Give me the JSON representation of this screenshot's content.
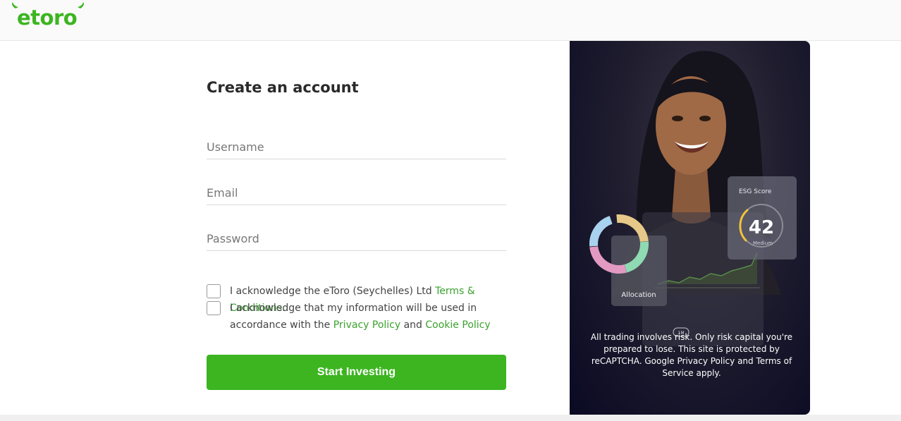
{
  "brand": {
    "name": "eToro",
    "logo_text": "eToro",
    "accent": "#3cb521",
    "link_color": "#3aa22d",
    "panel_bg": "#0b0a24"
  },
  "form": {
    "title": "Create an account",
    "username_placeholder": "Username",
    "email_placeholder": "Email",
    "password_placeholder": "Password",
    "consent_terms": {
      "prefix": "I acknowledge the eToro (Seychelles) Ltd ",
      "link": "Terms & Conditions",
      "suffix": ".",
      "checked": false
    },
    "consent_privacy": {
      "prefix": "I acknowledge that my information will be used in accordance with the ",
      "link1": "Privacy Policy",
      "middle": " and ",
      "link2": "Cookie Policy",
      "checked": false
    },
    "submit_label": "Start Investing"
  },
  "promo": {
    "esg_title": "ESG Score",
    "esg_value": "42",
    "esg_level": "Medium",
    "allocation_label": "Allocation",
    "chart_period": "1M",
    "disclaimer": "All trading involves risk. Only risk capital you're prepared to lose. This site is protected by reCAPTCHA. Google Privacy Policy and Terms of Service apply."
  }
}
